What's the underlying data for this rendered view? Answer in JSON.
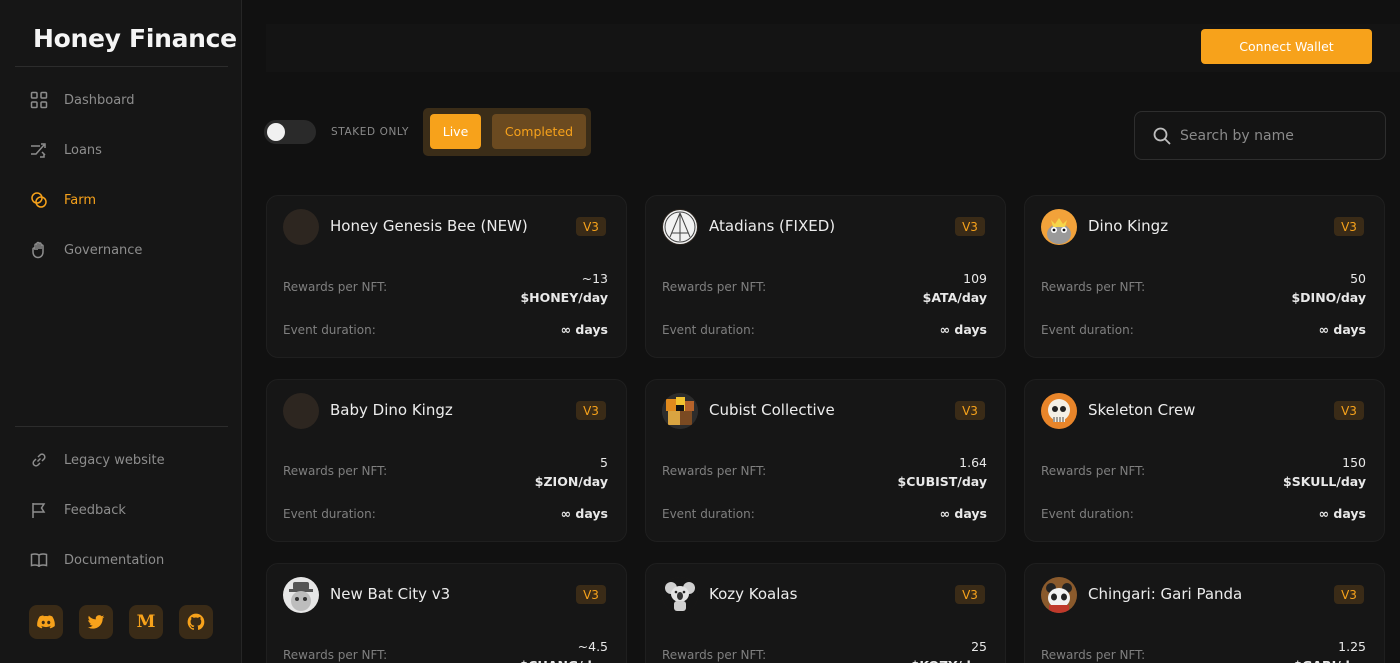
{
  "app": {
    "brand": "Honey Finance"
  },
  "colors": {
    "accent": "#f7a21b",
    "background": "#111111",
    "card": "#161616"
  },
  "sidebar": {
    "nav": [
      {
        "label": "Dashboard",
        "icon": "grid-icon",
        "active": false
      },
      {
        "label": "Loans",
        "icon": "swap-arrows-icon",
        "active": false
      },
      {
        "label": "Farm",
        "icon": "coins-icon",
        "active": true
      },
      {
        "label": "Governance",
        "icon": "hand-icon",
        "active": false
      }
    ],
    "links": [
      {
        "label": "Legacy website",
        "icon": "link-icon"
      },
      {
        "label": "Feedback",
        "icon": "flag-icon"
      },
      {
        "label": "Documentation",
        "icon": "book-icon"
      }
    ],
    "socials": [
      "discord-icon",
      "twitter-icon",
      "medium-icon",
      "github-icon"
    ]
  },
  "header": {
    "connect_label": "Connect Wallet"
  },
  "filters": {
    "staked_only_label": "STAKED ONLY",
    "staked_only_on": false,
    "live_label": "Live",
    "completed_label": "Completed",
    "search_placeholder": "Search by name"
  },
  "cards": [
    {
      "name": "Honey Genesis Bee (NEW)",
      "version": "V3",
      "rewards_label": "Rewards per NFT:",
      "rewards_amount": "~13",
      "rewards_unit": "$HONEY/day",
      "duration_label": "Event duration:",
      "duration_value": "∞ days",
      "avatar": "blank"
    },
    {
      "name": "Atadians (FIXED)",
      "version": "V3",
      "rewards_label": "Rewards per NFT:",
      "rewards_amount": "109",
      "rewards_unit": "$ATA/day",
      "duration_label": "Event duration:",
      "duration_value": "∞ days",
      "avatar": "atadians"
    },
    {
      "name": "Dino Kingz",
      "version": "V3",
      "rewards_label": "Rewards per NFT:",
      "rewards_amount": "50",
      "rewards_unit": "$DINO/day",
      "duration_label": "Event duration:",
      "duration_value": "∞ days",
      "avatar": "dino"
    },
    {
      "name": "Baby Dino Kingz",
      "version": "V3",
      "rewards_label": "Rewards per NFT:",
      "rewards_amount": "5",
      "rewards_unit": "$ZION/day",
      "duration_label": "Event duration:",
      "duration_value": "∞ days",
      "avatar": "blank"
    },
    {
      "name": "Cubist Collective",
      "version": "V3",
      "rewards_label": "Rewards per NFT:",
      "rewards_amount": "1.64",
      "rewards_unit": "$CUBIST/day",
      "duration_label": "Event duration:",
      "duration_value": "∞ days",
      "avatar": "cubist"
    },
    {
      "name": "Skeleton Crew",
      "version": "V3",
      "rewards_label": "Rewards per NFT:",
      "rewards_amount": "150",
      "rewards_unit": "$SKULL/day",
      "duration_label": "Event duration:",
      "duration_value": "∞ days",
      "avatar": "skeleton"
    },
    {
      "name": "New Bat City v3",
      "version": "V3",
      "rewards_label": "Rewards per NFT:",
      "rewards_amount": "~4.5",
      "rewards_unit": "$CHANG/day",
      "duration_label": "",
      "duration_value": "",
      "avatar": "batcity"
    },
    {
      "name": "Kozy Koalas",
      "version": "V3",
      "rewards_label": "Rewards per NFT:",
      "rewards_amount": "25",
      "rewards_unit": "$KOZY/day",
      "duration_label": "",
      "duration_value": "",
      "avatar": "koala"
    },
    {
      "name": "Chingari: Gari Panda",
      "version": "V3",
      "rewards_label": "Rewards per NFT:",
      "rewards_amount": "1.25",
      "rewards_unit": "$GARI/day",
      "duration_label": "",
      "duration_value": "",
      "avatar": "panda"
    }
  ]
}
